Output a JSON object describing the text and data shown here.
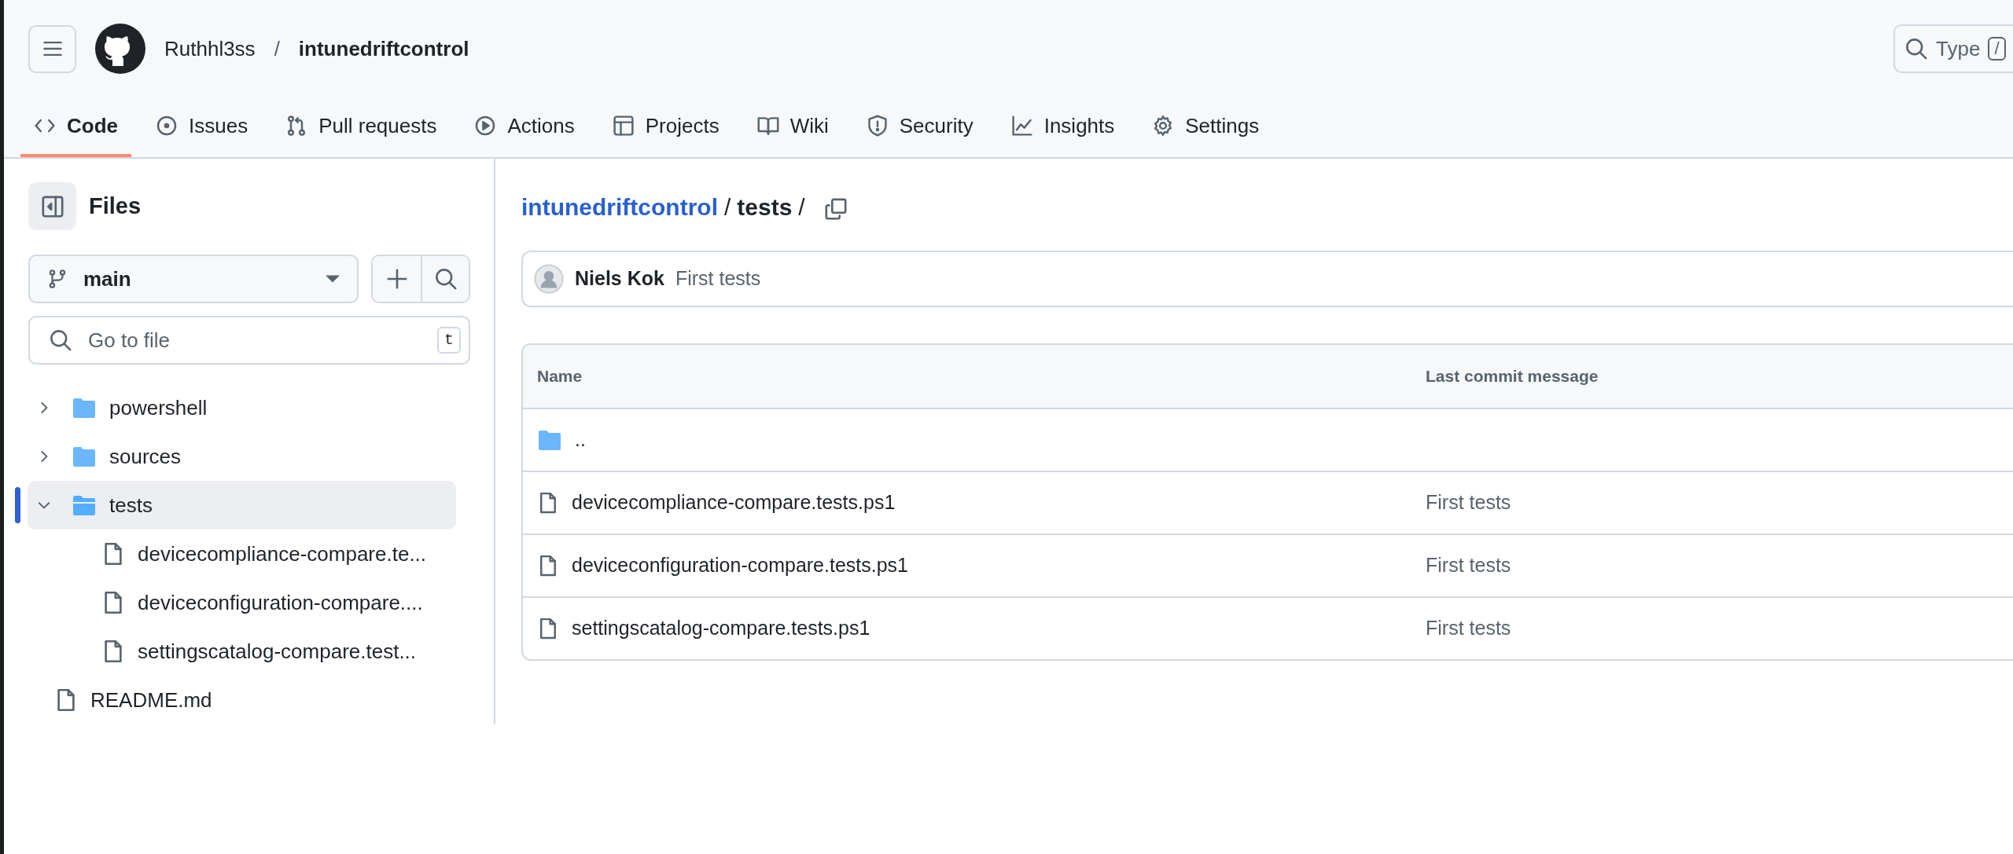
{
  "header": {
    "owner": "Ruthhl3ss",
    "separator": "/",
    "repo": "intunedriftcontrol",
    "search": {
      "placeholder": "Type",
      "key_hint": "/"
    }
  },
  "tabs": [
    {
      "label": "Code",
      "kind": "code",
      "selected": true
    },
    {
      "label": "Issues",
      "kind": "issues",
      "selected": false
    },
    {
      "label": "Pull requests",
      "kind": "pull",
      "selected": false
    },
    {
      "label": "Actions",
      "kind": "actions",
      "selected": false
    },
    {
      "label": "Projects",
      "kind": "projects",
      "selected": false
    },
    {
      "label": "Wiki",
      "kind": "wiki",
      "selected": false
    },
    {
      "label": "Security",
      "kind": "security",
      "selected": false
    },
    {
      "label": "Insights",
      "kind": "insights",
      "selected": false
    },
    {
      "label": "Settings",
      "kind": "settings",
      "selected": false
    }
  ],
  "sidebar": {
    "title": "Files",
    "branch": "main",
    "filter": {
      "placeholder": "Go to file",
      "key_hint": "t"
    },
    "tree": [
      {
        "name": "powershell",
        "kind": "folder",
        "expanded": false,
        "selected": false
      },
      {
        "name": "sources",
        "kind": "folder",
        "expanded": false,
        "selected": false
      },
      {
        "name": "tests",
        "kind": "folder",
        "expanded": true,
        "selected": true,
        "children": [
          {
            "name": "devicecompliance-compare.te...",
            "kind": "file",
            "selected": false
          },
          {
            "name": "deviceconfiguration-compare....",
            "kind": "file",
            "selected": false
          },
          {
            "name": "settingscatalog-compare.test...",
            "kind": "file",
            "selected": false
          }
        ]
      },
      {
        "name": "README.md",
        "kind": "file",
        "selected": false
      }
    ]
  },
  "breadcrumb": {
    "repo": "intunedriftcontrol",
    "separator": "/",
    "path": [
      "tests"
    ]
  },
  "latest_commit": {
    "author": "Niels Kok",
    "message": "First tests"
  },
  "table": {
    "columns": [
      "Name",
      "Last commit message"
    ],
    "rows": [
      {
        "name": "..",
        "kind": "parent"
      },
      {
        "name": "devicecompliance-compare.tests.ps1",
        "kind": "file",
        "message": "First tests"
      },
      {
        "name": "deviceconfiguration-compare.tests.ps1",
        "kind": "file",
        "message": "First tests"
      },
      {
        "name": "settingscatalog-compare.tests.ps1",
        "kind": "file",
        "message": "First tests"
      }
    ]
  }
}
